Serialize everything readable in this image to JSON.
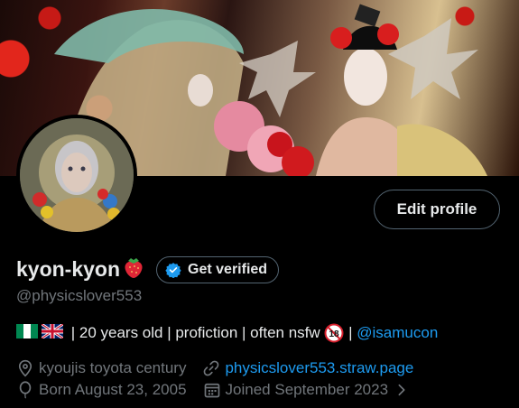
{
  "profile": {
    "display_name": "kyon-kyon",
    "name_emoji": "strawberry",
    "handle": "@physicslover553",
    "edit_profile_label": "Edit profile",
    "get_verified_label": "Get verified",
    "bio": {
      "flags": [
        "nigeria-flag",
        "uk-flag"
      ],
      "text": " | 20 years old | profiction | often nsfw ",
      "age_badge": "18",
      "separator": " | ",
      "mention": "@isamucon"
    },
    "location": "kyoujis toyota century",
    "website": "physicslover553.straw.page",
    "birthday": "Born August 23, 2005",
    "joined": "Joined September 2023"
  },
  "colors": {
    "background": "#000000",
    "text": "#e7e9ea",
    "muted": "#71767b",
    "accent": "#1d9bf0",
    "border": "#536471"
  },
  "icons": {
    "location": "location-pin-icon",
    "website": "link-icon",
    "birthday": "balloon-icon",
    "joined": "calendar-icon",
    "verified": "verified-badge-icon",
    "chevron": "chevron-right-icon"
  }
}
